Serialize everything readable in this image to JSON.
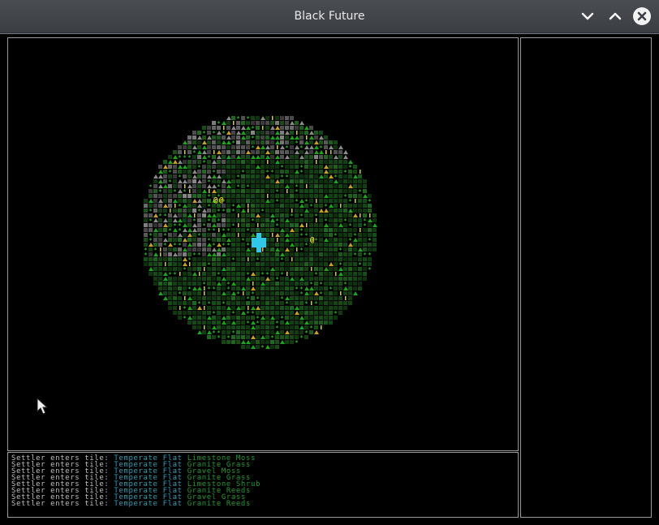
{
  "window": {
    "title": "Black Future",
    "controls": [
      "minimize",
      "maximize",
      "close"
    ]
  },
  "map": {
    "settler_glyph": "@",
    "settler_color": "#f2e200",
    "player_color": "#31c7e8",
    "colors": {
      "ground": "#1f6b1f",
      "ground_dim": "#145014",
      "tree": "#2fd32f",
      "mountain": "#1aa61a",
      "rock": "#8a8a8a",
      "rock_dim": "#5a5a5a",
      "sand": "#c8a020",
      "reed": "#d9d400"
    },
    "settlers": [
      {
        "label": "@"
      },
      {
        "label": "@"
      },
      {
        "label": "@"
      }
    ]
  },
  "log": {
    "lines": [
      {
        "prefix": "Settler enters tile:",
        "climate": "Temperate Flat",
        "material": "Limestone Moss"
      },
      {
        "prefix": "Settler enters tile:",
        "climate": "Temperate Flat",
        "material": "Granite Grass"
      },
      {
        "prefix": "Settler enters tile:",
        "climate": "Temperate Flat",
        "material": "Gravel Moss"
      },
      {
        "prefix": "Settler enters tile:",
        "climate": "Temperate Flat",
        "material": "Granite Grass"
      },
      {
        "prefix": "Settler enters tile:",
        "climate": "Temperate Flat",
        "material": "Limestone Shrub"
      },
      {
        "prefix": "Settler enters tile:",
        "climate": "Temperate Flat",
        "material": "Granite Reeds"
      },
      {
        "prefix": "Settler enters tile:",
        "climate": "Temperate Flat",
        "material": "Gravel Grass"
      },
      {
        "prefix": "Settler enters tile:",
        "climate": "Temperate Flat",
        "material": "Granite Reeds"
      }
    ]
  }
}
